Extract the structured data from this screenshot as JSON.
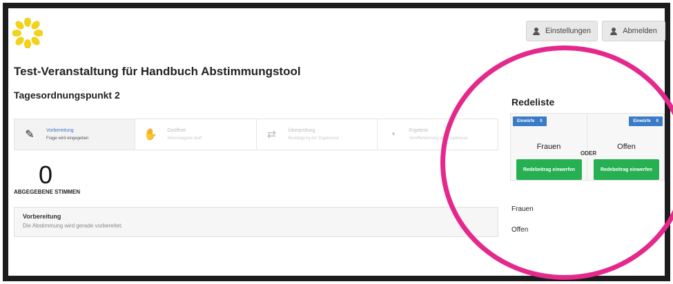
{
  "header": {
    "settings_label": "Einstellungen",
    "logout_label": "Abmelden"
  },
  "page": {
    "title": "Test-Veranstaltung für Handbuch Abstimmungstool",
    "agenda_item": "Tagesordnungspunkt 2"
  },
  "steps": [
    {
      "title": "Vorbereitung",
      "subtitle": "Frage wird eingegeben",
      "icon": "pencil-icon",
      "active": true
    },
    {
      "title": "Geöffnet",
      "subtitle": "Stimmabgabe läuft",
      "icon": "hand-icon",
      "active": false
    },
    {
      "title": "Überprüfung",
      "subtitle": "Bestätigung der Ergebnisse",
      "icon": "handshake-icon",
      "active": false
    },
    {
      "title": "Ergebnis",
      "subtitle": "Veröffentlichung der Ergebnisse",
      "icon": "pie-chart-icon",
      "active": false
    }
  ],
  "votes": {
    "count": "0",
    "label": "ABGEGEBENE STIMMEN"
  },
  "info": {
    "title": "Vorbereitung",
    "text": "Die Abstimmung wird gerade vorbereitet."
  },
  "speakers": {
    "heading": "Redeliste",
    "separator": "ODER",
    "columns": [
      {
        "badge_label": "Einwürfe",
        "badge_count": "0",
        "label": "Frauen",
        "button": "Redebeitrag einwerfen"
      },
      {
        "badge_label": "Einwürfe",
        "badge_count": "0",
        "label": "Offen",
        "button": "Redebeitrag einwerfen"
      }
    ],
    "lists": [
      "Frauen",
      "Offen"
    ]
  },
  "colors": {
    "accent_blue": "#3a7cc6",
    "button_green": "#27b052",
    "highlight_ring": "#e4288c"
  }
}
